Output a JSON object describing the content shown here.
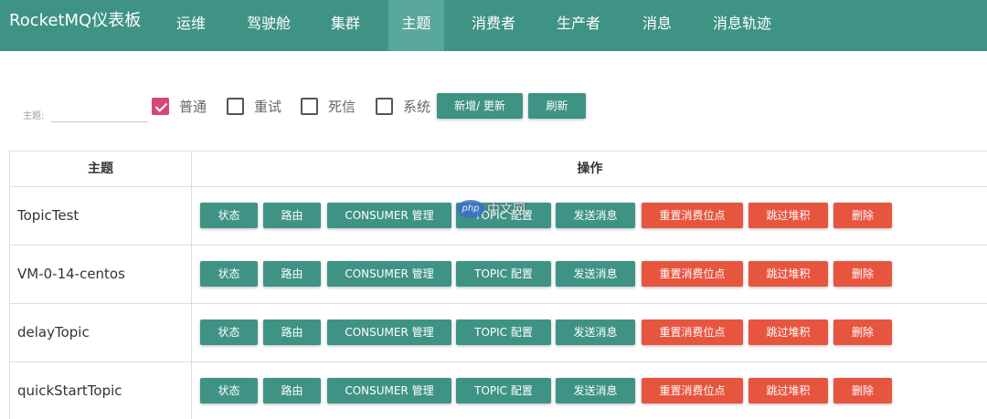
{
  "brand": "RocketMQ仪表板",
  "nav": [
    {
      "label": "运维"
    },
    {
      "label": "驾驶舱"
    },
    {
      "label": "集群"
    },
    {
      "label": "主题",
      "active": true
    },
    {
      "label": "消费者"
    },
    {
      "label": "生产者"
    },
    {
      "label": "消息"
    },
    {
      "label": "消息轨迹"
    }
  ],
  "filter": {
    "label": "主题:",
    "value": "",
    "placeholder": "",
    "checkboxes": [
      {
        "label": "普通",
        "checked": true
      },
      {
        "label": "重试",
        "checked": false
      },
      {
        "label": "死信",
        "checked": false
      },
      {
        "label": "系统",
        "checked": false
      }
    ],
    "add_button": "新增/ 更新",
    "refresh_button": "刷新"
  },
  "table": {
    "headers": [
      "主题",
      "操作"
    ],
    "actions": [
      {
        "label": "状态",
        "color": "green"
      },
      {
        "label": "路由",
        "color": "green"
      },
      {
        "label": "CONSUMER 管理",
        "color": "green"
      },
      {
        "label": "TOPIC 配置",
        "color": "green"
      },
      {
        "label": "发送消息",
        "color": "green"
      },
      {
        "label": "重置消费位点",
        "color": "red"
      },
      {
        "label": "跳过堆积",
        "color": "red"
      },
      {
        "label": "删除",
        "color": "red"
      }
    ],
    "rows": [
      "TopicTest",
      "VM-0-14-centos",
      "delayTopic",
      "quickStartTopic"
    ]
  },
  "colors": {
    "primary": "#3f9384",
    "danger": "#e8553f",
    "checkbox": "#d6477a"
  },
  "watermark": {
    "logo": "php",
    "text": "中文网"
  }
}
